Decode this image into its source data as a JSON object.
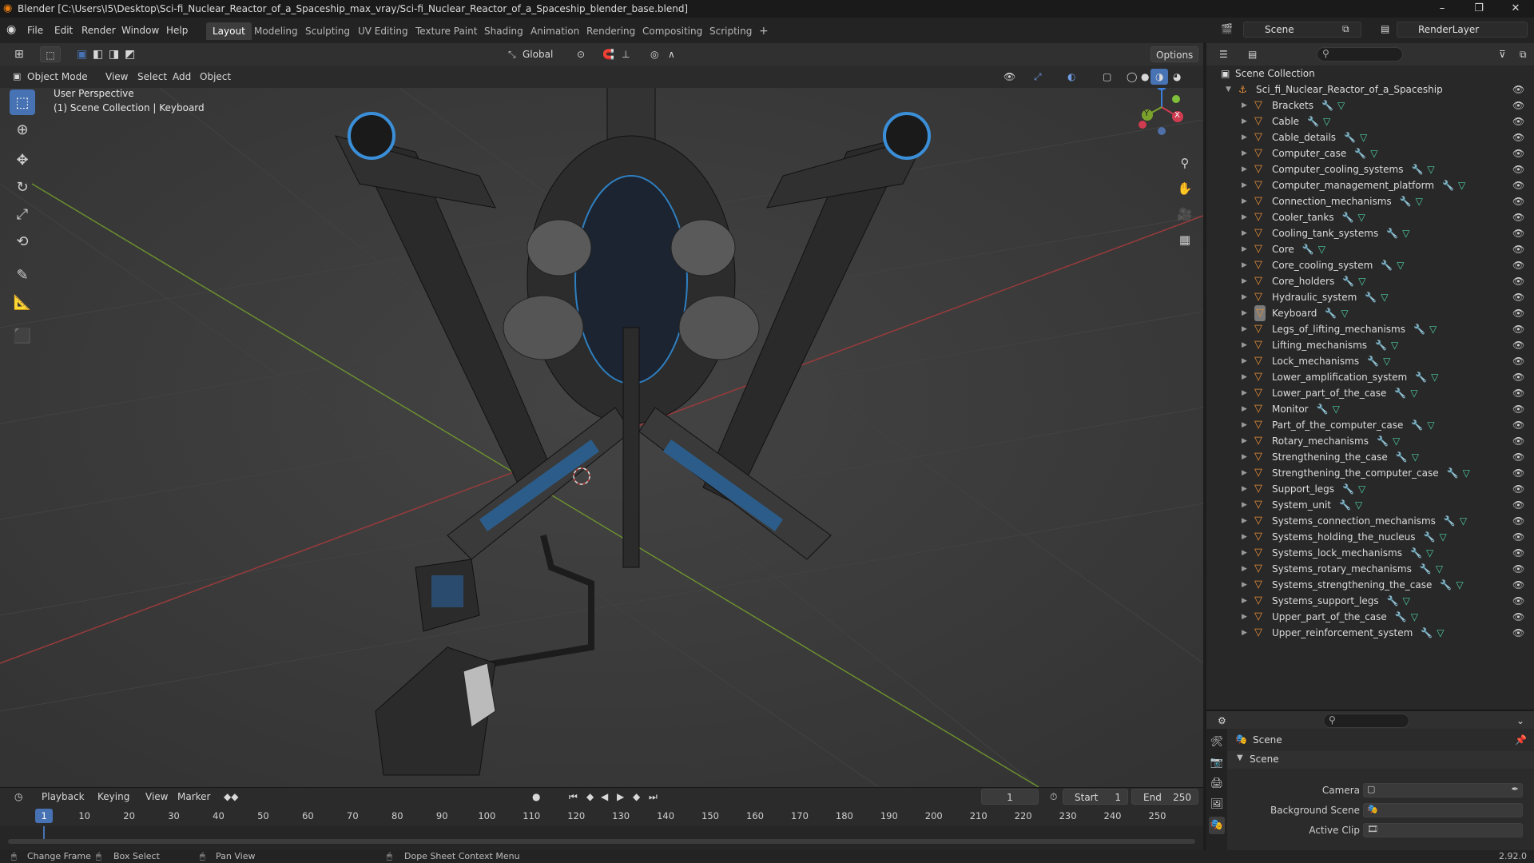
{
  "window": {
    "title": "Blender [C:\\Users\\I5\\Desktop\\Sci-fi_Nuclear_Reactor_of_a_Spaceship_max_vray/Sci-fi_Nuclear_Reactor_of_a_Spaceship_blender_base.blend]",
    "minimize": "–",
    "maximize": "❐",
    "close": "✕"
  },
  "menus": [
    "File",
    "Edit",
    "Render",
    "Window",
    "Help"
  ],
  "workspaces": [
    "Layout",
    "Modeling",
    "Sculpting",
    "UV Editing",
    "Texture Paint",
    "Shading",
    "Animation",
    "Rendering",
    "Compositing",
    "Scripting"
  ],
  "workspace_add": "+",
  "scene_name": "Scene",
  "renderlayer_name": "RenderLayer",
  "toolbar": {
    "orientation": "Global",
    "options": "Options"
  },
  "viewport_header": {
    "mode": "Object Mode",
    "menus": [
      "View",
      "Select",
      "Add",
      "Object"
    ]
  },
  "viewport": {
    "perspective_label": "User Perspective",
    "collection_label": "(1) Scene Collection | Keyboard",
    "gizmo": {
      "x": "X",
      "y": "Y",
      "z": "Z"
    },
    "colors": {
      "grid_x": "#9a3b3b",
      "grid_y": "#6b8f2f",
      "bg": "#3a3a3a"
    }
  },
  "outliner": {
    "root": "Scene Collection",
    "collection": "Sci_fi_Nuclear_Reactor_of_a_Spaceship",
    "items": [
      "Brackets",
      "Cable",
      "Cable_details",
      "Computer_case",
      "Computer_cooling_systems",
      "Computer_management_platform",
      "Connection_mechanisms",
      "Cooler_tanks",
      "Cooling_tank_systems",
      "Core",
      "Core_cooling_system",
      "Core_holders",
      "Hydraulic_system",
      "Keyboard",
      "Legs_of_lifting_mechanisms",
      "Lifting_mechanisms",
      "Lock_mechanisms",
      "Lower_amplification_system",
      "Lower_part_of_the_case",
      "Monitor",
      "Part_of_the_computer_case",
      "Rotary_mechanisms",
      "Strengthening_the_case",
      "Strengthening_the_computer_case",
      "Support_legs",
      "System_unit",
      "Systems_connection_mechanisms",
      "Systems_holding_the_nucleus",
      "Systems_lock_mechanisms",
      "Systems_rotary_mechanisms",
      "Systems_strengthening_the_case",
      "Systems_support_legs",
      "Upper_part_of_the_case",
      "Upper_reinforcement_system"
    ],
    "selected": "Keyboard"
  },
  "properties": {
    "context": "Scene",
    "panel": "Scene",
    "fields": [
      {
        "label": "Camera",
        "value": ""
      },
      {
        "label": "Background Scene",
        "value": ""
      },
      {
        "label": "Active Clip",
        "value": ""
      }
    ]
  },
  "timeline": {
    "menus": [
      "Playback",
      "Keying",
      "View",
      "Marker"
    ],
    "current_frame": "1",
    "start_label": "Start",
    "start": "1",
    "end_label": "End",
    "end": "250",
    "ticks": [
      "1",
      "10",
      "20",
      "30",
      "40",
      "50",
      "60",
      "70",
      "80",
      "90",
      "100",
      "110",
      "120",
      "130",
      "140",
      "150",
      "160",
      "170",
      "180",
      "190",
      "200",
      "210",
      "220",
      "230",
      "240",
      "250"
    ]
  },
  "statusbar": {
    "items": [
      "Change Frame",
      "Box Select",
      "Pan View",
      "Dope Sheet Context Menu"
    ],
    "version": "2.92.0"
  }
}
